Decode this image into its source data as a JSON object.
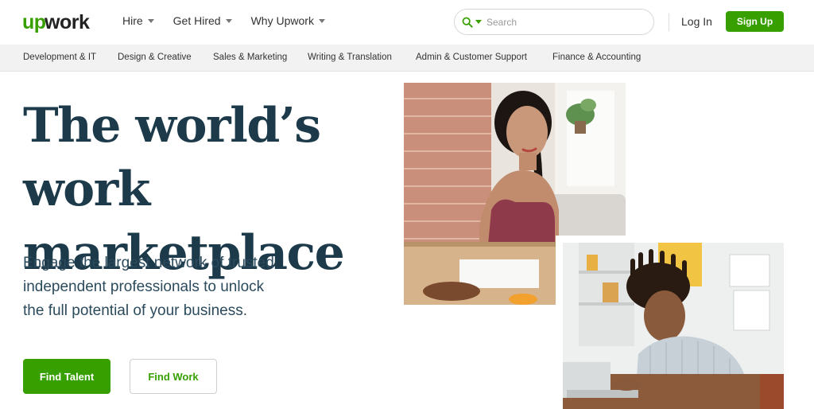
{
  "header": {
    "logo_text": "upwork",
    "nav": [
      {
        "label": "Hire"
      },
      {
        "label": "Get Hired"
      },
      {
        "label": "Why Upwork"
      }
    ],
    "search": {
      "placeholder": "Search"
    },
    "login_label": "Log In",
    "signup_label": "Sign Up"
  },
  "categories": [
    "Development & IT",
    "Design & Creative",
    "Sales & Marketing",
    "Writing & Translation",
    "Admin & Customer Support",
    "Finance & Accounting"
  ],
  "hero": {
    "headline_line1": "The world’s work",
    "headline_line2": "marketplace",
    "subtext_line1": "Engage the largest network of trusted",
    "subtext_line2": "independent professionals to unlock",
    "subtext_line3": "the full potential of your business.",
    "primary_button": "Find Talent",
    "secondary_button": "Find Work"
  },
  "colors": {
    "brand_green": "#37a000",
    "headline": "#1c3a4a",
    "catbar_bg": "#f2f2f2"
  },
  "icons": {
    "search": "search-icon",
    "caret": "chevron-down-icon"
  }
}
